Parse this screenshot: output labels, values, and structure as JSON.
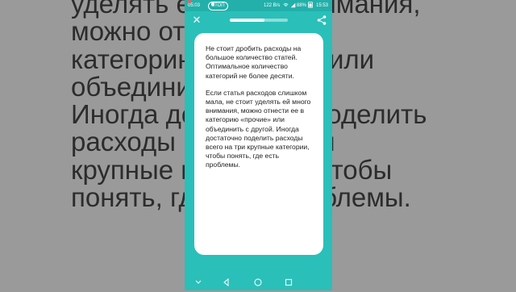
{
  "background_text": {
    "lines": [
      "уделять ей много внимания,",
      "можно отнести ее в",
      "категорию «прочие» или",
      "объединить с другой.",
      "Иногда достаточно поделить",
      "расходы всего на три",
      "крупные категории, чтобы",
      "понять, где есть проблемы."
    ]
  },
  "status_bar": {
    "left_time": "05:03",
    "stop_label": "СТОП",
    "speed": "122 B/s",
    "battery": "88%",
    "time": "15:53"
  },
  "top_bar": {
    "close_icon": "close-icon",
    "share_icon": "share-icon",
    "progress": 0.6
  },
  "card": {
    "paragraph1": "Не стоит дробить расходы на большое количество статей. Оптимальное количество категорий не более десяти.",
    "paragraph2": "Если статья расходов слишком мала, не стоит уделять ей много внимания, можно отнести ее в категорию «прочие» или объединить с другой. Иногда достаточно поделить расходы всего на три крупные категории, чтобы понять, где есть проблемы."
  },
  "nav_bar": {
    "icons": [
      "chevron-down-icon",
      "back-icon",
      "home-icon",
      "recents-icon"
    ]
  },
  "colors": {
    "accent": "#2bbfb9",
    "background": "#9a9a9a",
    "card": "#ffffff"
  }
}
